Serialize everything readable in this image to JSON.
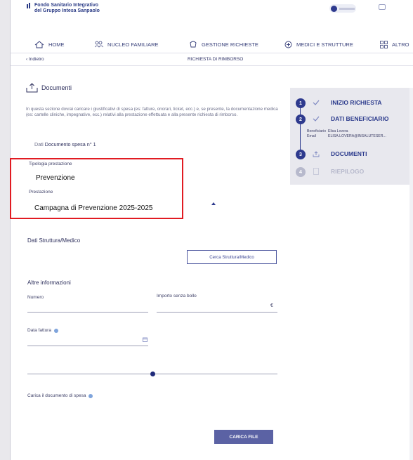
{
  "header": {
    "logo_line1": "Fondo Sanitario Integrativo",
    "logo_line2": "del Gruppo Intesa Sanpaolo"
  },
  "nav": {
    "items": [
      {
        "label": "HOME",
        "icon": "home-icon"
      },
      {
        "label": "NUCLEO FAMILIARE",
        "icon": "family-icon"
      },
      {
        "label": "GESTIONE RICHIESTE",
        "icon": "requests-icon"
      },
      {
        "label": "MEDICI E STRUTTURE",
        "icon": "medical-icon"
      },
      {
        "label": "ALTRO",
        "icon": "grid-icon"
      }
    ]
  },
  "subbar": {
    "back_label": "‹ Indietro",
    "page_title": "RICHIESTA DI RIMBORSO"
  },
  "documents": {
    "title": "Documenti",
    "icon": "upload-tray-icon",
    "description": "In questa sezione dovrai caricare i giustificativi di spesa (es: fatture, onorari, ticket, ecc.) e, se presente, la documentazione medica (es: cartelle cliniche, impegnative, ecc.) relativi alla prestazione effettuata e alla presente richiesta di rimborso.",
    "doc_heading_prefix": "Dati",
    "doc_heading_main": "Documento spesa n° 1"
  },
  "prestazione": {
    "tipologia_label": "Tipologia prestazione",
    "tipologia_value": "Prevenzione",
    "prestazione_label": "Prestazione",
    "prestazione_value": "Campagna di Prevenzione 2025-2025"
  },
  "struttura": {
    "title": "Dati Struttura/Medico",
    "search_button": "Cerca Struttura/Medico"
  },
  "altre": {
    "title": "Altre informazioni",
    "numero_label": "Numero",
    "importo_label": "Importo senza bollo",
    "currency": "€",
    "data_fattura_label": "Data fattura",
    "slider_level": 0.5
  },
  "upload": {
    "label": "Carica il documento di spesa",
    "button": "CARICA FILE"
  },
  "steps": [
    {
      "number": "1",
      "title": "INIZIO RICHIESTA",
      "status": "done"
    },
    {
      "number": "2",
      "title": "DATI BENEFICIARIO",
      "status": "done"
    },
    {
      "number": "3",
      "title": "DOCUMENTI",
      "status": "current"
    },
    {
      "number": "4",
      "title": "RIEPILOGO",
      "status": "todo"
    }
  ],
  "beneficiario": {
    "beneficiario_label": "Beneficiario",
    "beneficiario_value": "Elisa Lovera",
    "email_label": "Email",
    "email_value": "ELISA.LOVERA@INSALUTESER..."
  },
  "colors": {
    "accent": "#2e3a8e",
    "button": "#5b62a4",
    "highlight_border": "#e11b22",
    "steps_panel": "#e8e8ee"
  }
}
